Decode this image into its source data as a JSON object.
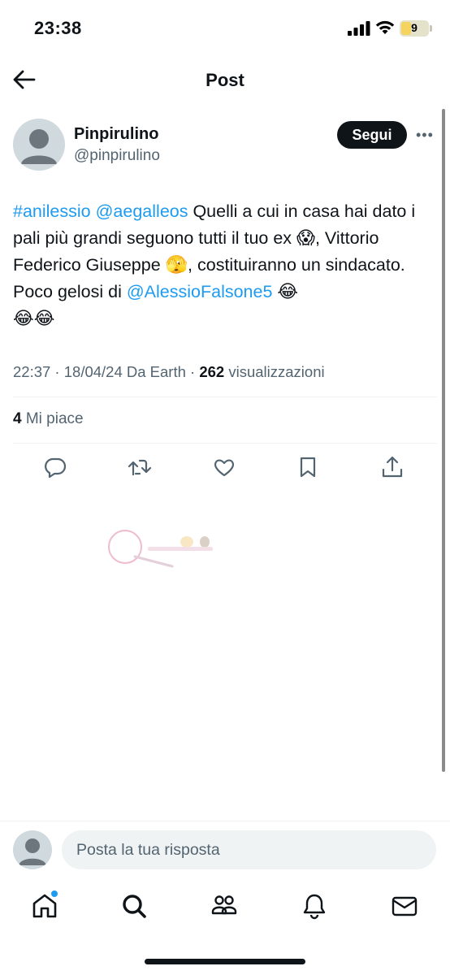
{
  "status_bar": {
    "time": "23:38",
    "battery": "9"
  },
  "header": {
    "title": "Post"
  },
  "author": {
    "name": "Pinpirulino",
    "handle": "@pinpirulino"
  },
  "follow_label": "Segui",
  "tweet": {
    "hashtag": "#anilessio",
    "mention1": "@aegalleos",
    "text1": " Quelli a cui in casa hai dato i pali più grandi seguono tutti il tuo ex ",
    "emoji1": "😱",
    "text2": ", Vittorio Federico Giuseppe ",
    "emoji2": "🫣",
    "text3": ", costituiranno un sindacato. Poco gelosi di ",
    "mention2": "@AlessioFalsone5",
    "emoji3": "😂",
    "emoji4": "😂😂"
  },
  "meta": {
    "time_date": "22:37 · 18/04/24 Da Earth · ",
    "views_count": "262",
    "views_label": " visualizzazioni"
  },
  "likes": {
    "count": "4",
    "label": " Mi piace"
  },
  "actions": [
    "reply-icon",
    "retweet-icon",
    "like-icon",
    "bookmark-icon",
    "share-icon"
  ],
  "reply": {
    "placeholder": "Posta la tua risposta"
  },
  "nav": [
    "home-icon",
    "search-icon",
    "communities-icon",
    "notifications-icon",
    "messages-icon"
  ],
  "colors": {
    "accent": "#1d9bf0",
    "text": "#0f1419",
    "secondary": "#536471"
  }
}
